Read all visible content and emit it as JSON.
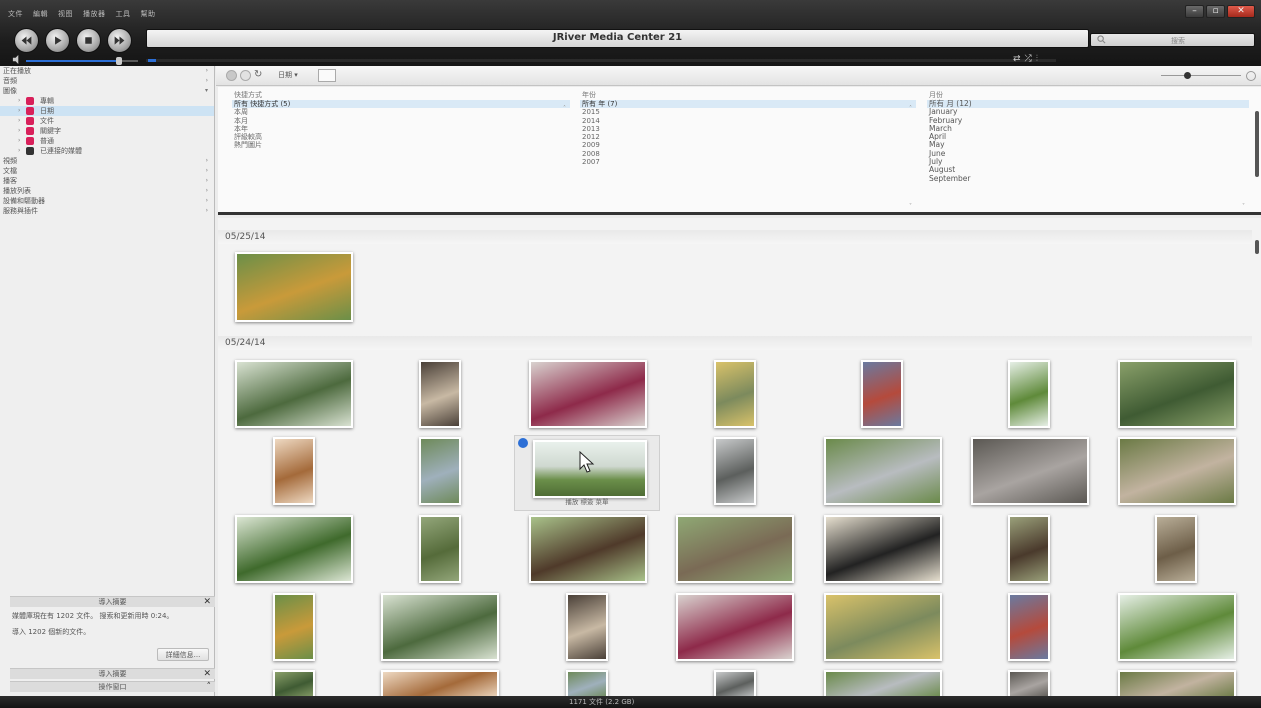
{
  "app": {
    "title": "JRiver Media Center 21"
  },
  "menu": [
    "文件",
    "編輯",
    "视图",
    "播放器",
    "工具",
    "幫助"
  ],
  "search": {
    "placeholder": "搜索"
  },
  "sidebar": {
    "items": [
      {
        "label": "正在播放",
        "arrow": "›"
      },
      {
        "label": "音頻",
        "arrow": "›"
      },
      {
        "label": "圖像",
        "arrow": "▾"
      },
      {
        "label": "專輯",
        "child": true
      },
      {
        "label": "日期",
        "child": true,
        "selected": true
      },
      {
        "label": "文件",
        "child": true
      },
      {
        "label": "關鍵字",
        "child": true
      },
      {
        "label": "普通",
        "child": true
      },
      {
        "label": "已連接的媒體",
        "child": true,
        "dark": true
      },
      {
        "label": "視頻",
        "arrow": "›"
      },
      {
        "label": "文檔",
        "arrow": "›"
      },
      {
        "label": "播客",
        "arrow": "›"
      },
      {
        "label": "播放列表",
        "arrow": "›"
      },
      {
        "label": "設備和驅動器",
        "arrow": "›"
      },
      {
        "label": "服務與插件",
        "arrow": "›"
      }
    ]
  },
  "import_panel": {
    "title": "導入摘要",
    "line1": "媒體庫現在有 1202 文件。 搜索和更新用時 0:24。",
    "line2": "導入 1202 個新的文件。",
    "details_button": "詳細信息...",
    "summary_label": "導入摘要",
    "action_window_label": "操作窗口"
  },
  "toolbar": {
    "view_label": "日期 ▾"
  },
  "categories": {
    "quick": {
      "header": "快捷方式",
      "items": [
        "所有 快捷方式 (5)",
        "本周",
        "本月",
        "本年",
        "評級較高",
        "熱門圖片"
      ]
    },
    "year": {
      "header": "年份",
      "items": [
        "所有 年 (7)",
        "2015",
        "2014",
        "2013",
        "2012",
        "2009",
        "2008",
        "2007"
      ]
    },
    "month": {
      "header": "月份",
      "items": [
        "所有 月 (12)",
        "January",
        "February",
        "March",
        "April",
        "May",
        "June",
        "July",
        "August",
        "September"
      ]
    }
  },
  "groups": [
    {
      "date": "05/25/14"
    },
    {
      "date": "05/24/14"
    }
  ],
  "hover_card": {
    "caption": "播放 標簽 菜單"
  },
  "status": {
    "text": "1171 文件 (2.2 GB)"
  },
  "colors": {
    "accent": "#2c6fd6",
    "chrome": "#1e1e1e",
    "close": "#c0392b"
  }
}
